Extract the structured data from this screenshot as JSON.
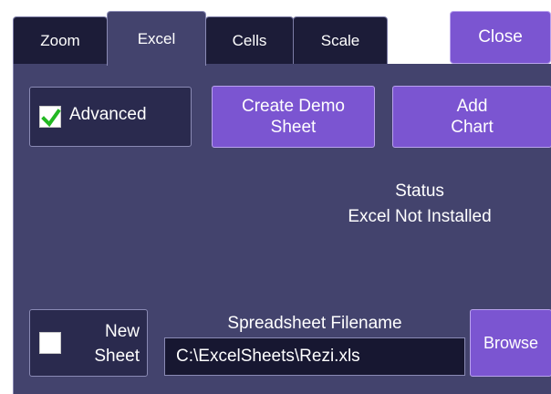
{
  "tabs": [
    {
      "label": "Zoom",
      "active": false
    },
    {
      "label": "Excel",
      "active": true
    },
    {
      "label": "Cells",
      "active": false
    },
    {
      "label": "Scale",
      "active": false
    }
  ],
  "close_label": "Close",
  "advanced": {
    "label": "Advanced",
    "checked": true
  },
  "create_demo_sheet": {
    "line1": "Create Demo",
    "line2": "Sheet"
  },
  "add_chart": {
    "line1": "Add",
    "line2": "Chart"
  },
  "status": {
    "title": "Status",
    "value": "Excel Not Installed"
  },
  "new_sheet": {
    "line1": "New",
    "line2": "Sheet",
    "checked": false
  },
  "spreadsheet": {
    "label": "Spreadsheet Filename",
    "value": "C:\\ExcelSheets\\Rezi.xls"
  },
  "browse_label": "Browse",
  "colors": {
    "panel": "#43436d",
    "tab_inactive": "#1c1c38",
    "button": "#7b55d1",
    "check": "#22b822"
  }
}
